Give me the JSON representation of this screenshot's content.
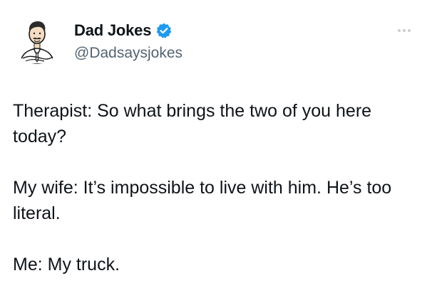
{
  "tweet": {
    "author": {
      "display_name": "Dad Jokes",
      "handle": "@Dadsaysjokes",
      "verified": true,
      "avatar_icon": "cartoon-man-avatar",
      "verified_icon": "verified-badge-icon",
      "verified_color": "#1d9bf0"
    },
    "more_icon": "more-horizontal-icon",
    "paragraphs": [
      "Therapist: So what brings the two of you here today?",
      "My wife: It’s impossible to live with him. He’s too literal.",
      "Me: My truck."
    ]
  },
  "colors": {
    "text": "#0f1419",
    "secondary_text": "#536471",
    "background": "#ffffff"
  }
}
